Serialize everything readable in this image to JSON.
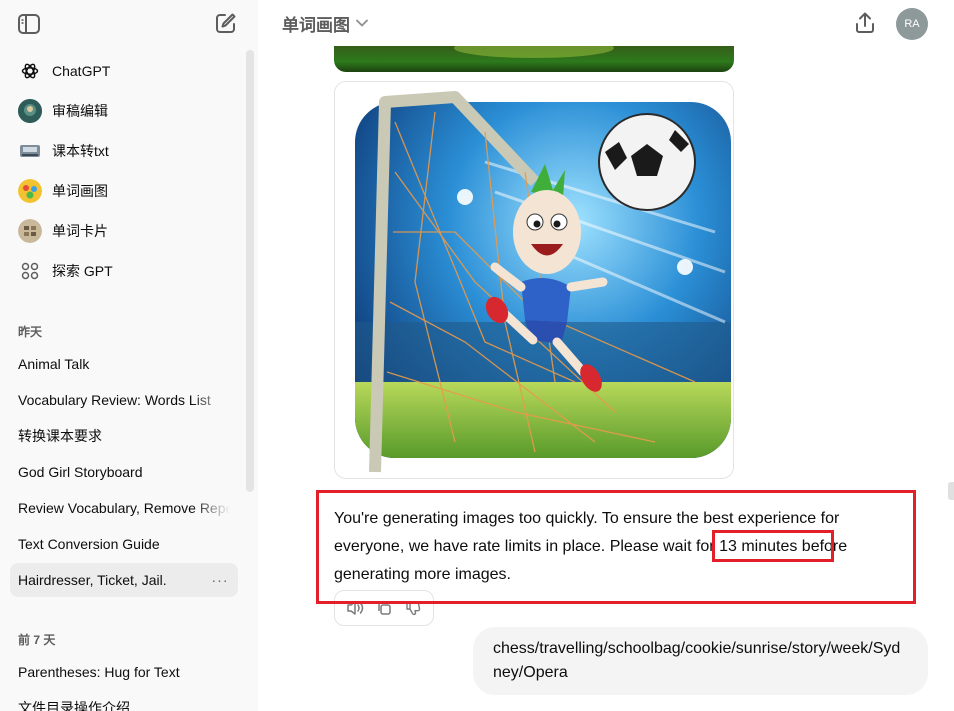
{
  "sidebar": {
    "gpts": [
      {
        "label": "ChatGPT",
        "icon": "openai-logo-icon"
      },
      {
        "label": "审稿编辑",
        "icon": "gpt-avatar-review-icon"
      },
      {
        "label": "课本转txt",
        "icon": "gpt-avatar-textbook-icon"
      },
      {
        "label": "单词画图",
        "icon": "gpt-avatar-word-art-icon"
      },
      {
        "label": "单词卡片",
        "icon": "gpt-avatar-flashcard-icon"
      },
      {
        "label": "探索 GPT",
        "icon": "grid-icon"
      }
    ],
    "sections": [
      {
        "label": "昨天",
        "items": [
          {
            "label": "Animal Talk"
          },
          {
            "label": "Vocabulary Review: Words List"
          },
          {
            "label": "转换课本要求"
          },
          {
            "label": "God Girl Storyboard"
          },
          {
            "label": "Review Vocabulary, Remove Repetition"
          },
          {
            "label": "Text Conversion Guide"
          },
          {
            "label": "Hairdresser, Ticket, Jail."
          }
        ]
      },
      {
        "label": "前 7 天",
        "items": [
          {
            "label": "Parentheses: Hug for Text"
          },
          {
            "label": "文件目录操作介绍"
          }
        ]
      }
    ],
    "more_label": "···"
  },
  "header": {
    "model_name": "单词画图",
    "avatar_initials": "RA"
  },
  "conversation": {
    "assistant_message": {
      "text_before": "You're generating images too quickly. To ensure the best experience for everyone, we have rate limits in place. Please wait ",
      "highlight": "for 13 minutes",
      "text_after": " before generating more images."
    },
    "user_message": "chess/travelling/schoolbag/cookie/sunrise/story/week/Sydney/Opera"
  },
  "colors": {
    "highlight_box": "#e3202a",
    "sidebar_bg": "#f9f9f9",
    "active_item_bg": "#ececec",
    "user_bubble_bg": "#f4f4f4",
    "avatar_bg": "#8e9a9a"
  }
}
